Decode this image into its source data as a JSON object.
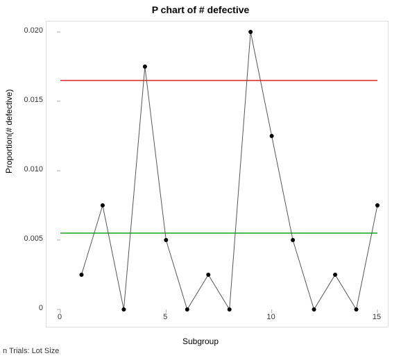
{
  "chart_data": {
    "type": "line",
    "title": "P chart of # defective",
    "xlabel": "Subgroup",
    "ylabel": "Proportion(# defective)",
    "x": [
      1,
      2,
      3,
      4,
      5,
      6,
      7,
      8,
      9,
      10,
      11,
      12,
      13,
      14,
      15
    ],
    "values": [
      0.0025,
      0.0075,
      0.0,
      0.0175,
      0.005,
      0.0,
      0.0025,
      0.0,
      0.02,
      0.0125,
      0.005,
      0.0,
      0.0025,
      0.0,
      0.0075
    ],
    "center_line": 0.0055,
    "ucl": 0.0165,
    "xlim": [
      0,
      15
    ],
    "ylim": [
      0,
      0.02
    ],
    "y_ticks": [
      0,
      0.005,
      0.01,
      0.015,
      0.02
    ],
    "x_ticks": [
      0,
      5,
      10,
      15
    ],
    "footer": "n Trials: Lot Size",
    "colors": {
      "center_line": "#1fa01f",
      "ucl": "#d62728",
      "series": "#555555",
      "point": "#000000"
    }
  }
}
